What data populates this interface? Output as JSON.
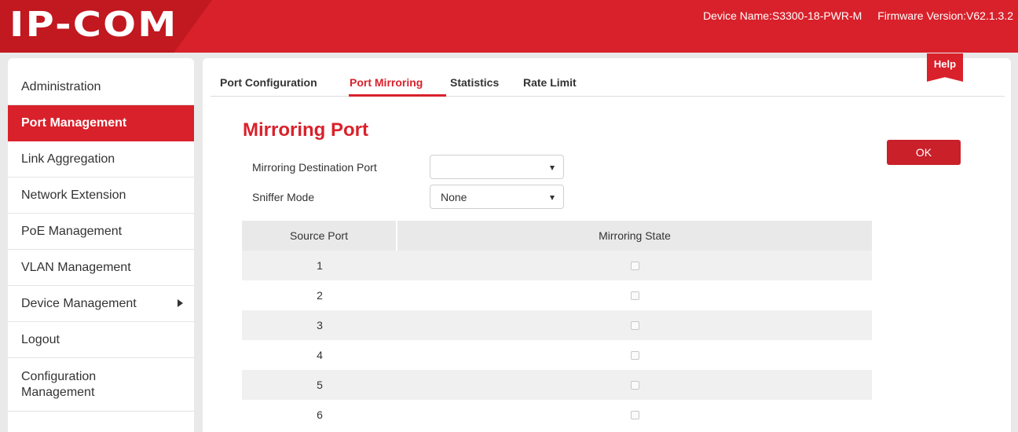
{
  "header": {
    "logo_text": "IP-COM",
    "device_name": "Device Name:S3300-18-PWR-M",
    "firmware_version": "Firmware Version:V62.1.3.2"
  },
  "sidebar": {
    "items": [
      {
        "label": "Administration",
        "active": false
      },
      {
        "label": "Port Management",
        "active": true
      },
      {
        "label": "Link Aggregation",
        "active": false
      },
      {
        "label": "Network Extension",
        "active": false
      },
      {
        "label": "PoE Management",
        "active": false
      },
      {
        "label": "VLAN Management",
        "active": false
      },
      {
        "label": "Device Management",
        "active": false,
        "has_submenu": true
      },
      {
        "label": "Logout",
        "active": false
      },
      {
        "label": "Configuration Management",
        "active": false
      }
    ]
  },
  "tabs": [
    {
      "label": "Port Configuration",
      "active": false
    },
    {
      "label": "Port Mirroring",
      "active": true
    },
    {
      "label": "Statistics",
      "active": false
    },
    {
      "label": "Rate Limit",
      "active": false
    }
  ],
  "help_label": "Help",
  "section_title": "Mirroring Port",
  "ok_label": "OK",
  "form": {
    "destination_port": {
      "label": "Mirroring Destination Port",
      "value": ""
    },
    "sniffer_mode": {
      "label": "Sniffer Mode",
      "value": "None"
    }
  },
  "table": {
    "headers": [
      "Source Port",
      "Mirroring State"
    ],
    "rows": [
      {
        "port": "1",
        "mirroring": false
      },
      {
        "port": "2",
        "mirroring": false
      },
      {
        "port": "3",
        "mirroring": false
      },
      {
        "port": "4",
        "mirroring": false
      },
      {
        "port": "5",
        "mirroring": false
      },
      {
        "port": "6",
        "mirroring": false
      }
    ]
  },
  "colors": {
    "brand_red": "#d9212b",
    "background_grey": "#e9e9e9"
  }
}
